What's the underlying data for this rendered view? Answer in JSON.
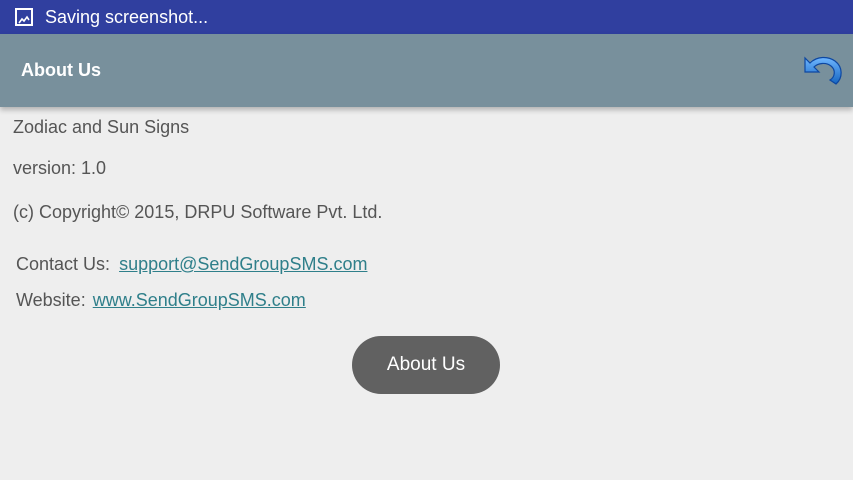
{
  "status_bar": {
    "notification_text": "Saving screenshot...",
    "icon": "image-icon",
    "background": "#303f9f"
  },
  "app_bar": {
    "title": "About Us",
    "back_icon": "undo-arrow-icon",
    "background": "#78909c"
  },
  "content": {
    "app_name": "Zodiac and Sun Signs",
    "version": "version: 1.0",
    "copyright": "(c) Copyright© 2015, DRPU Software Pvt. Ltd.",
    "contact_label": "Contact Us:",
    "contact_email": "support@SendGroupSMS.com",
    "website_label": "Website:",
    "website_url": "www.SendGroupSMS.com",
    "link_color": "#2f7f8a"
  },
  "button": {
    "label": "About Us",
    "background": "#616161"
  }
}
